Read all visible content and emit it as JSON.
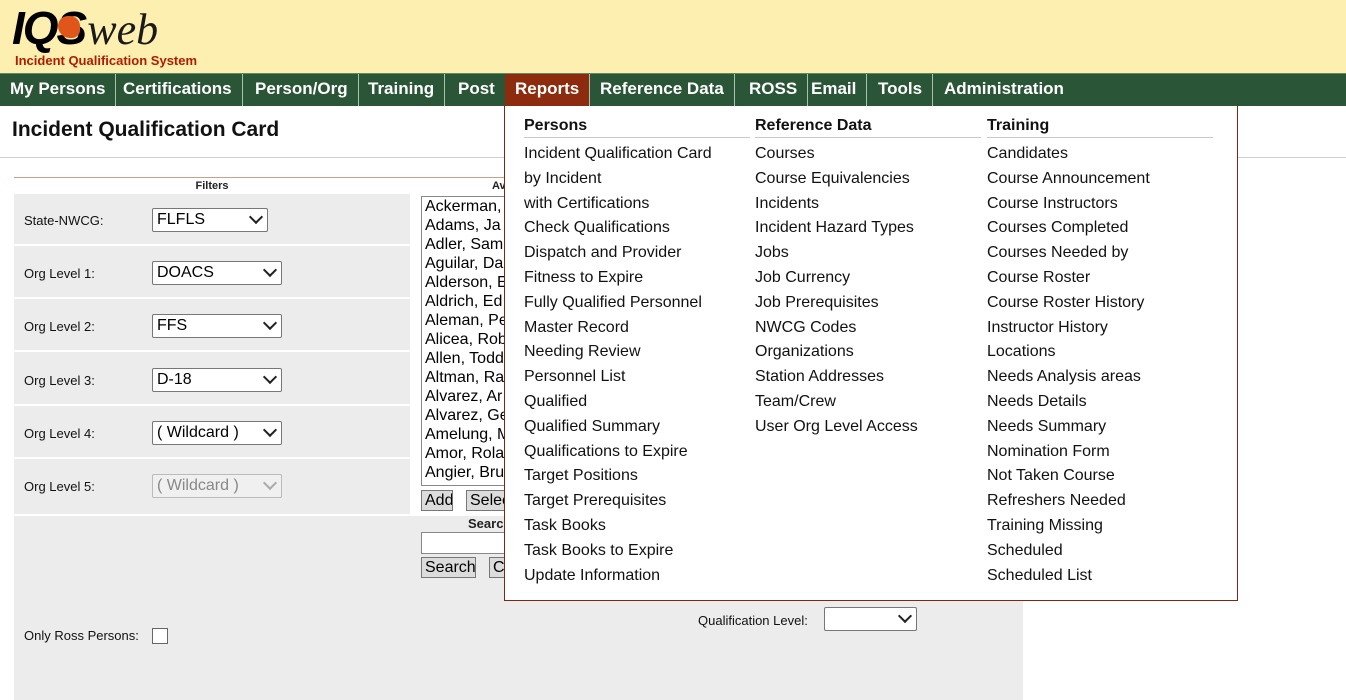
{
  "app": {
    "logo_main": "IQS",
    "logo_web": "web",
    "logo_subtitle": "Incident Qualification System"
  },
  "nav": {
    "items": [
      "My Persons",
      "Certifications",
      "Person/Org",
      "Training",
      "Post",
      "Reports",
      "Reference Data",
      "ROSS",
      "Email",
      "Tools",
      "Administration"
    ],
    "active": "Reports"
  },
  "page": {
    "title": "Incident Qualification Card"
  },
  "filters": {
    "heading": "Filters",
    "rows": [
      {
        "label": "State-NWCG:",
        "value": "FLFLS"
      },
      {
        "label": "Org Level 1:",
        "value": "DOACS"
      },
      {
        "label": "Org Level 2:",
        "value": "FFS"
      },
      {
        "label": "Org Level 3:",
        "value": "D-18"
      },
      {
        "label": "Org Level 4:",
        "value": "( Wildcard )"
      },
      {
        "label": "Org Level 5:",
        "value": "( Wildcard )"
      }
    ],
    "ross_label": "Only Ross Persons:",
    "qualification_level_label": "Qualification Level:"
  },
  "available": {
    "heading": "Av",
    "persons": [
      "Ackerman,",
      "Adams, Ja",
      "Adler, Sam",
      "Aguilar, Da",
      "Alderson, E",
      "Aldrich, Ed",
      "Aleman, Pe",
      "Alicea, Rob",
      "Allen, Todd",
      "Altman, Ra",
      "Alvarez, Ar",
      "Alvarez, Ge",
      "Amelung, M",
      "Amor, Rola",
      "Angier, Bru"
    ],
    "add_label": "Add",
    "select_label": "Selec",
    "search_heading": "Search",
    "search_button": "Search",
    "clear_button": "C"
  },
  "reports_menu": {
    "columns": [
      {
        "heading": "Persons",
        "items": [
          "Incident Qualification Card",
          "by Incident",
          "with Certifications",
          "Check Qualifications",
          "Dispatch and Provider",
          "Fitness to Expire",
          "Fully Qualified Personnel",
          "Master Record",
          "Needing Review",
          "Personnel List",
          "Qualified",
          "Qualified Summary",
          "Qualifications to Expire",
          "Target Positions",
          "Target Prerequisites",
          "Task Books",
          "Task Books to Expire",
          "Update Information"
        ]
      },
      {
        "heading": "Reference Data",
        "items": [
          "Courses",
          "Course Equivalencies",
          "Incidents",
          "Incident Hazard Types",
          "Jobs",
          "Job Currency",
          "Job Prerequisites",
          "NWCG Codes",
          "Organizations",
          "Station Addresses",
          "Team/Crew",
          "User Org Level Access"
        ]
      },
      {
        "heading": "Training",
        "items": [
          "Candidates",
          "Course Announcement",
          "Course Instructors",
          "Courses Completed",
          "Courses Needed by",
          "Course Roster",
          "Course Roster History",
          "Instructor History",
          "Locations",
          "Needs Analysis areas",
          "Needs Details",
          "Needs Summary",
          "Nomination Form",
          "Not Taken Course",
          "Refreshers Needed",
          "Training Missing",
          "Scheduled",
          "Scheduled List"
        ]
      }
    ]
  }
}
